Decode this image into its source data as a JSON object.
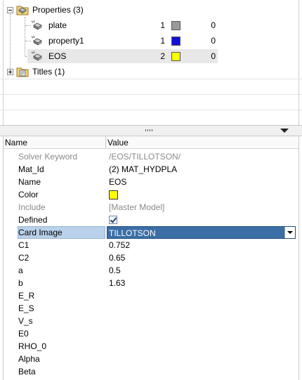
{
  "tree": {
    "properties_label": "Properties (3)",
    "titles_label": "Titles (1)",
    "items": [
      {
        "label": "plate",
        "id": "1",
        "color": "#9a9a9a",
        "value": "0"
      },
      {
        "label": "property1",
        "id": "1",
        "color": "#1010d8",
        "value": "0"
      },
      {
        "label": "EOS",
        "id": "2",
        "color": "#ffff00",
        "value": "0"
      }
    ]
  },
  "grid": {
    "header_name": "Name",
    "header_value": "Value",
    "rows": [
      {
        "name": "Solver Keyword",
        "value": "/EOS/TILLOTSON/"
      },
      {
        "name": "Mat_Id",
        "value": "(2) MAT_HYDPLA"
      },
      {
        "name": "Name",
        "value": "EOS"
      },
      {
        "name": "Color",
        "value": "",
        "color": "#ffff00"
      },
      {
        "name": "Include",
        "value": "[Master Model]"
      },
      {
        "name": "Defined",
        "value": "",
        "checked": true
      },
      {
        "name": "Card Image",
        "value": "TILLOTSON"
      },
      {
        "name": "C1",
        "value": "0.752"
      },
      {
        "name": "C2",
        "value": "0.65"
      },
      {
        "name": "a",
        "value": "0.5"
      },
      {
        "name": "b",
        "value": "1.63"
      },
      {
        "name": "E_R",
        "value": ""
      },
      {
        "name": "E_S",
        "value": ""
      },
      {
        "name": "V_s",
        "value": ""
      },
      {
        "name": "E0",
        "value": ""
      },
      {
        "name": "RHO_0",
        "value": ""
      },
      {
        "name": "Alpha",
        "value": ""
      },
      {
        "name": "Beta",
        "value": ""
      }
    ]
  },
  "icons": {
    "folder": "folder-icon",
    "property": "property-icon",
    "expand": "expand-icon",
    "collapse": "collapse-icon",
    "dropdown": "dropdown-arrow-icon",
    "grip": "splitter-grip-icon"
  }
}
